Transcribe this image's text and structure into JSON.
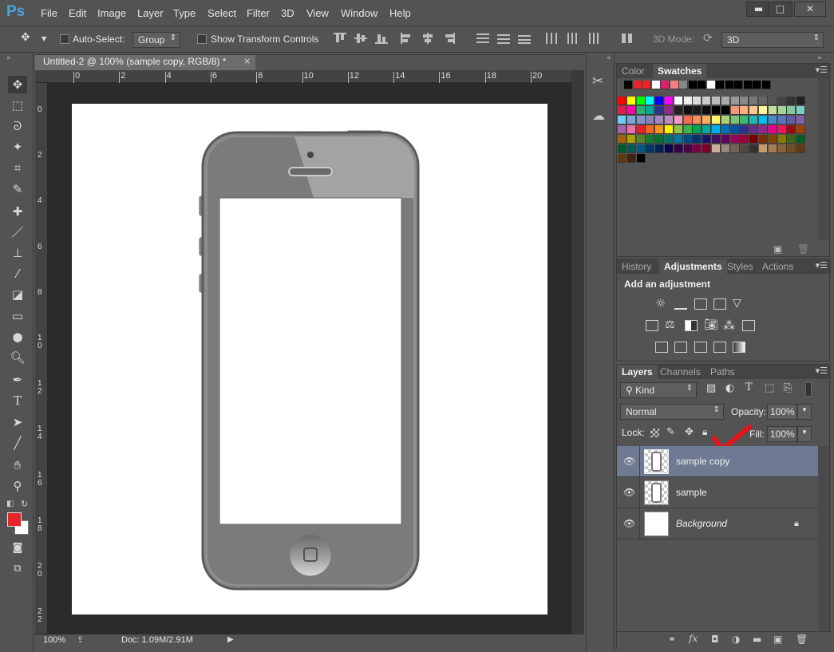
{
  "app": {
    "logo": "Ps",
    "menu": [
      "File",
      "Edit",
      "Image",
      "Layer",
      "Type",
      "Select",
      "Filter",
      "3D",
      "View",
      "Window",
      "Help"
    ],
    "window_controls": {
      "minimize": "▬",
      "maximize": "□",
      "close": "✕"
    }
  },
  "options_bar": {
    "auto_select_label": "Auto-Select:",
    "auto_select_value": "Group",
    "show_transform_label": "Show Transform Controls",
    "mode_label": "3D Mode:",
    "mode_value": "3D"
  },
  "document": {
    "tab_title": "Untitled-2 @ 100% (sample copy, RGB/8) *",
    "close": "×",
    "ruler_h": [
      "0",
      "2",
      "4",
      "6",
      "8",
      "10",
      "12",
      "14",
      "16",
      "18",
      "20"
    ],
    "ruler_v": [
      "0",
      "2",
      "4",
      "6",
      "8",
      "1\n0",
      "1\n2",
      "1\n4",
      "1\n6",
      "1\n8",
      "2\n0",
      "2\n2"
    ],
    "zoom": "100%",
    "doc_size": "Doc: 1.09M/2.91M"
  },
  "colors": {
    "foreground": "#e8242b",
    "background": "#ffffff"
  },
  "swatches_panel": {
    "tabs": [
      "Color",
      "Swatches"
    ],
    "active_tab": "Swatches"
  },
  "adjustments_panel": {
    "tabs": [
      "History",
      "Adjustments",
      "Styles",
      "Actions"
    ],
    "active_tab": "Adjustments",
    "heading": "Add an adjustment"
  },
  "layers_panel": {
    "tabs": [
      "Layers",
      "Channels",
      "Paths"
    ],
    "active_tab": "Layers",
    "filter_label": "Kind",
    "blend_mode": "Normal",
    "opacity_label": "Opacity:",
    "opacity_value": "100%",
    "lock_label": "Lock:",
    "fill_label": "Fill:",
    "fill_value": "100%",
    "layers": [
      {
        "name": "sample copy",
        "selected": true
      },
      {
        "name": "sample",
        "selected": false
      },
      {
        "name": "Background",
        "selected": false,
        "locked": true
      }
    ]
  }
}
